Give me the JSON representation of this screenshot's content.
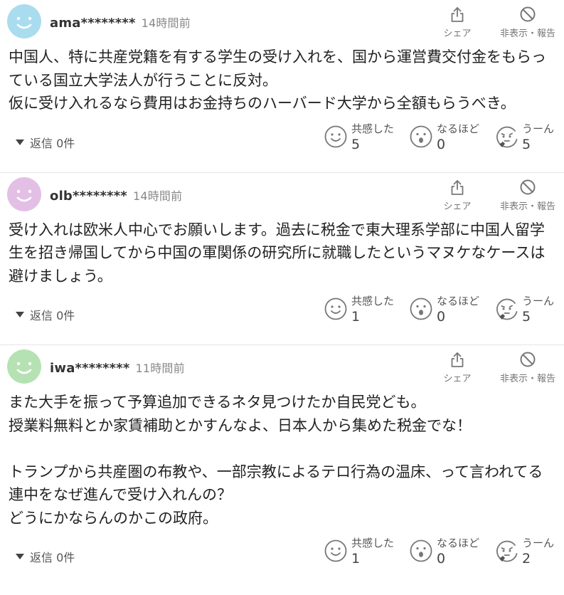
{
  "ui": {
    "share_label": "シェア",
    "hide_report_label": "非表示・報告",
    "reactions": {
      "empathy": "共感した",
      "indeed": "なるほど",
      "hmm": "うーん"
    }
  },
  "comments": [
    {
      "user": "ama********",
      "time": "14時間前",
      "avatar_color": "#a9dcef",
      "body": "中国人、特に共産党籍を有する学生の受け入れを、国から運営費交付金をもらっている国立大学法人が行うことに反対。\n仮に受け入れるなら費用はお金持ちのハーバード大学から全額もらうべき。",
      "reply": "返信 0件",
      "counts": {
        "empathy": "5",
        "indeed": "0",
        "hmm": "5"
      }
    },
    {
      "user": "olb********",
      "time": "14時間前",
      "avatar_color": "#e3bfe6",
      "body": "受け入れは欧米人中心でお願いします。過去に税金で東大理系学部に中国人留学生を招き帰国してから中国の軍関係の研究所に就職したというマヌケなケースは避けましょう。",
      "reply": "返信 0件",
      "counts": {
        "empathy": "1",
        "indeed": "0",
        "hmm": "5"
      }
    },
    {
      "user": "iwa********",
      "time": "11時間前",
      "avatar_color": "#b6e2b3",
      "body": "また大手を振って予算追加できるネタ見つけたか自民党ども。\n授業料無料とか家賃補助とかすんなよ、日本人から集めた税金でな！\n\nトランプから共産圏の布教や、一部宗教によるテロ行為の温床、って言われてる連中をなぜ進んで受け入れんの？\nどうにかならんのかこの政府。",
      "reply": "返信 0件",
      "counts": {
        "empathy": "1",
        "indeed": "0",
        "hmm": "2"
      }
    }
  ]
}
